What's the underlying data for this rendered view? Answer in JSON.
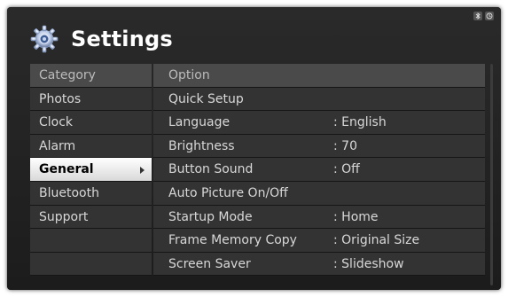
{
  "header": {
    "title": "Settings"
  },
  "status_icons": [
    "bluetooth-icon",
    "clock-icon"
  ],
  "category": {
    "header": "Category",
    "items": [
      {
        "label": "Photos"
      },
      {
        "label": "Clock"
      },
      {
        "label": "Alarm"
      },
      {
        "label": "General",
        "selected": true
      },
      {
        "label": "Bluetooth"
      },
      {
        "label": "Support"
      }
    ]
  },
  "options": {
    "header": "Option",
    "items": [
      {
        "label": "Quick Setup",
        "value": ""
      },
      {
        "label": "Language",
        "value": ": English"
      },
      {
        "label": "Brightness",
        "value": ": 70"
      },
      {
        "label": "Button Sound",
        "value": ": Off"
      },
      {
        "label": "Auto Picture On/Off",
        "value": ""
      },
      {
        "label": "Startup Mode",
        "value": ": Home"
      },
      {
        "label": "Frame Memory Copy",
        "value": ": Original Size"
      },
      {
        "label": "Screen Saver",
        "value": ": Slideshow"
      }
    ]
  },
  "colors": {
    "selected_bg": "#ffffff",
    "row_bg": "#333333",
    "header_bg": "#4a4a4a",
    "frame_bg": "#222222"
  }
}
